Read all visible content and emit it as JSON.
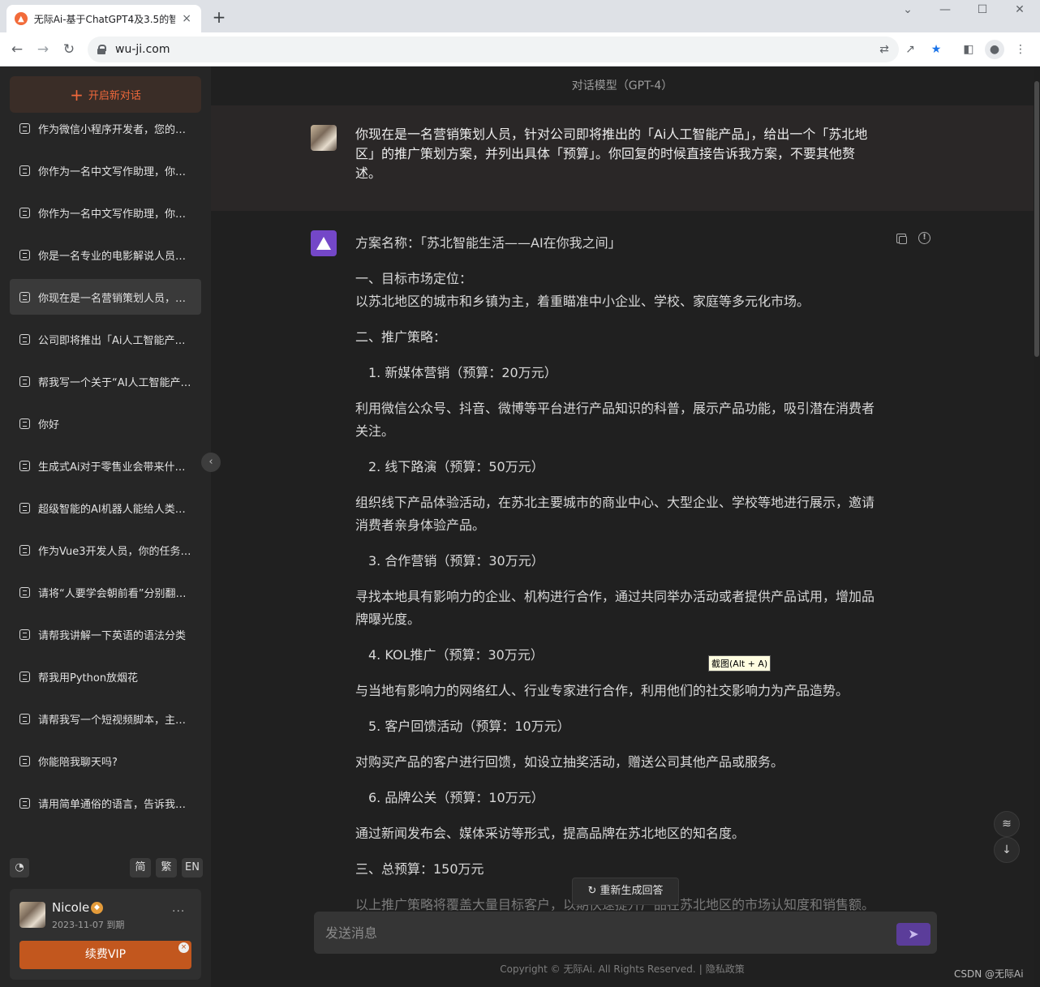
{
  "browser": {
    "tab_title": "无际Ai-基于ChatGPT4及3.5的智",
    "tab_close": "×",
    "new_tab": "+",
    "url": "wu-ji.com",
    "window_controls": [
      "⌄",
      "—",
      "☐",
      "✕"
    ]
  },
  "sidebar": {
    "new_chat_label": "开启新对话",
    "chats": [
      {
        "label": "作为微信小程序开发者，您的…",
        "active": false
      },
      {
        "label": "你作为一名中文写作助理，你…",
        "active": false
      },
      {
        "label": "你作为一名中文写作助理，你…",
        "active": false
      },
      {
        "label": "你是一名专业的电影解说人员…",
        "active": false
      },
      {
        "label": "你现在是一名营销策划人员，…",
        "active": true
      },
      {
        "label": "公司即将推出「Ai人工智能产…",
        "active": false
      },
      {
        "label": "帮我写一个关于“AI人工智能产…",
        "active": false
      },
      {
        "label": "你好",
        "active": false
      },
      {
        "label": "生成式Ai对于零售业会带来什…",
        "active": false
      },
      {
        "label": "超级智能的AI机器人能给人类…",
        "active": false
      },
      {
        "label": "作为Vue3开发人员，你的任务…",
        "active": false
      },
      {
        "label": "请将“人要学会朝前看”分别翻…",
        "active": false
      },
      {
        "label": "请帮我讲解一下英语的语法分类",
        "active": false
      },
      {
        "label": "帮我用Python放烟花",
        "active": false
      },
      {
        "label": "请帮我写一个短视频脚本，主…",
        "active": false
      },
      {
        "label": "你能陪我聊天吗?",
        "active": false
      },
      {
        "label": "请用简单通俗的语言，告诉我…",
        "active": false
      }
    ],
    "lang_options": [
      "简",
      "繁",
      "EN"
    ],
    "user": {
      "name": "Nicole",
      "expire": "2023-11-07 到期",
      "more": "···",
      "renew_label": "续费VIP"
    }
  },
  "main": {
    "model_title": "对话模型（GPT-4）",
    "user_message": "你现在是一名营销策划人员，针对公司即将推出的「Ai人工智能产品」，给出一个「苏北地区」的推广策划方案，并列出具体「预算」。你回复的时候直接告诉我方案，不要其他赘述。",
    "ai_reply": {
      "plan_name": "方案名称：「苏北智能生活——AI在你我之间」",
      "section1_title": "一、目标市场定位：",
      "section1_body": "以苏北地区的城市和乡镇为主，着重瞄准中小企业、学校、家庭等多元化市场。",
      "section2_title": "二、推广策略：",
      "strategies": [
        {
          "title": "1. 新媒体营销（预算：20万元）",
          "body": "利用微信公众号、抖音、微博等平台进行产品知识的科普，展示产品功能，吸引潜在消费者关注。"
        },
        {
          "title": "2. 线下路演（预算：50万元）",
          "body": "组织线下产品体验活动，在苏北主要城市的商业中心、大型企业、学校等地进行展示，邀请消费者亲身体验产品。"
        },
        {
          "title": "3. 合作营销（预算：30万元）",
          "body": "寻找本地具有影响力的企业、机构进行合作，通过共同举办活动或者提供产品试用，增加品牌曝光度。"
        },
        {
          "title": "4. KOL推广（预算：30万元）",
          "body": "与当地有影响力的网络红人、行业专家进行合作，利用他们的社交影响力为产品造势。"
        },
        {
          "title": "5. 客户回馈活动（预算：10万元）",
          "body": "对购买产品的客户进行回馈，如设立抽奖活动，赠送公司其他产品或服务。"
        },
        {
          "title": "6. 品牌公关（预算：10万元）",
          "body": "通过新闻发布会、媒体采访等形式，提高品牌在苏北地区的知名度。"
        }
      ],
      "section3_title": "三、总预算：150万元",
      "closing": "以上推广策略将覆盖大量目标客户，以期快速提升产品在苏北地区的市场认知度和销售额。"
    },
    "tooltip": "截图(Alt + A)",
    "regenerate_label": "重新生成回答",
    "input_placeholder": "发送消息",
    "copyright": "Copyright © 无际Ai. All Rights Reserved.",
    "privacy_link": "隐私政策"
  },
  "watermark": "CSDN @无际Ai",
  "colors": {
    "accent": "#f0683b",
    "ai_avatar": "#7447c8",
    "renew_button": "#c2571e",
    "send_button": "#5b3d9a"
  }
}
